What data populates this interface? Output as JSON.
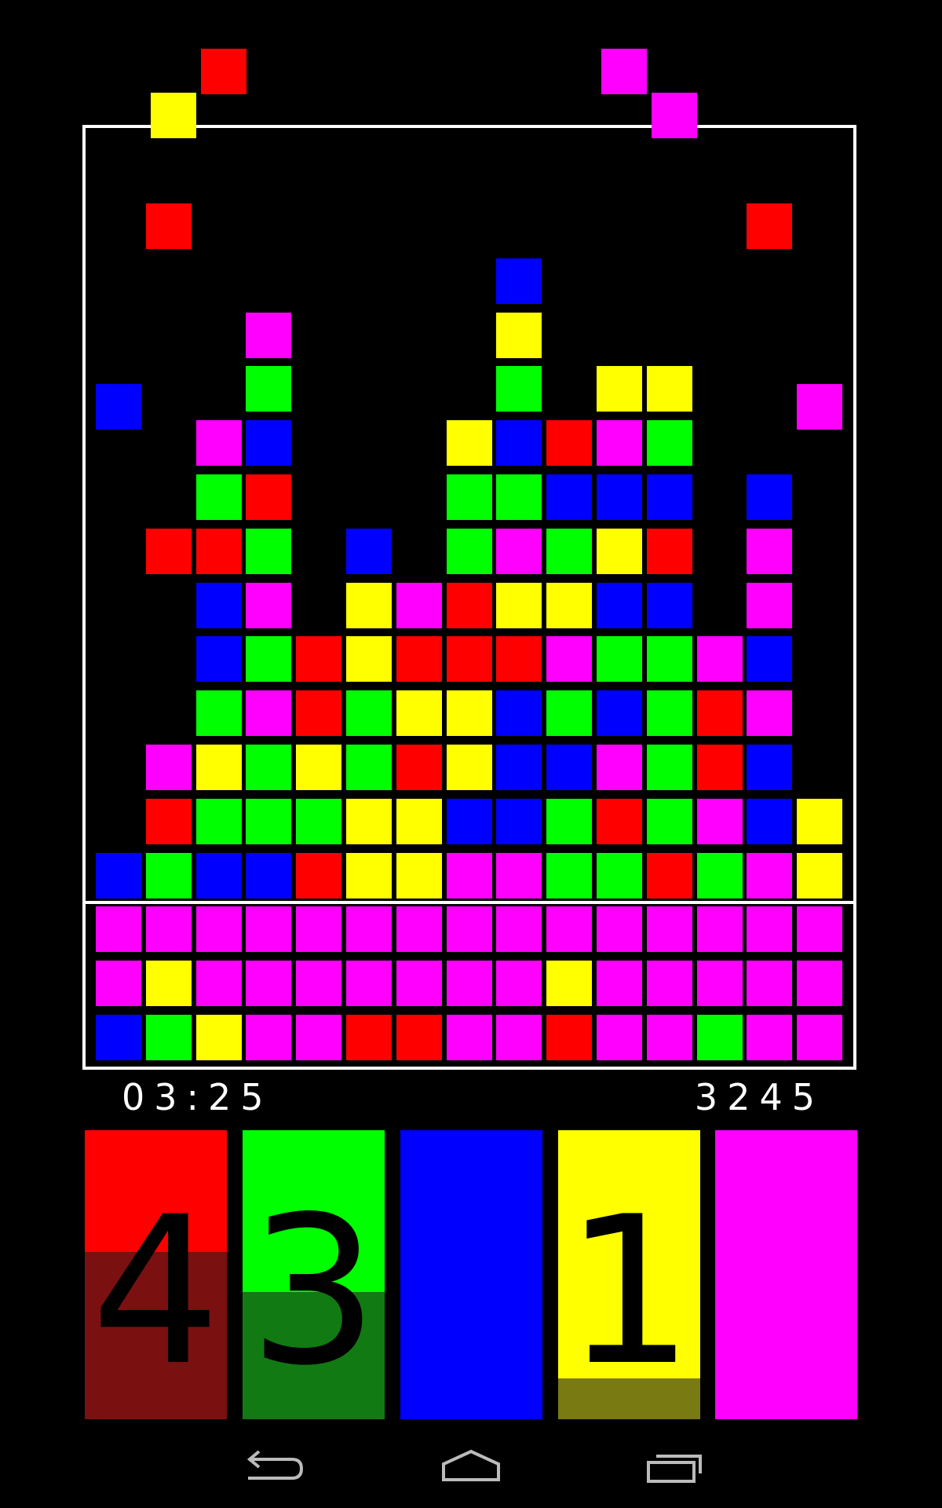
{
  "colors": {
    "R": "#ff0000",
    "G": "#00ff00",
    "B": "#0000ff",
    "Y": "#ffff00",
    "M": "#ff00ff"
  },
  "hud": {
    "timer": "03:25",
    "score": "3245"
  },
  "color_buttons": [
    {
      "color": "#ff0000",
      "shade": "#7a1010",
      "count": "4",
      "fill_fraction": 0.58
    },
    {
      "color": "#00ff00",
      "shade": "#127a12",
      "count": "3",
      "fill_fraction": 0.44
    },
    {
      "color": "#0000ff",
      "shade": "#0000ff",
      "count": "",
      "fill_fraction": 0
    },
    {
      "color": "#ffff00",
      "shade": "#7a7a12",
      "count": "1",
      "fill_fraction": 0.14
    },
    {
      "color": "#ff00ff",
      "shade": "#ff00ff",
      "count": "",
      "fill_fraction": 0
    }
  ],
  "incoming": [
    {
      "col": 2,
      "row": 0,
      "c": "R"
    },
    {
      "col": 1,
      "row": 1,
      "c": "Y"
    },
    {
      "col": 10,
      "row": 0,
      "c": "M"
    },
    {
      "col": 11,
      "row": 1,
      "c": "M"
    }
  ],
  "falling": [
    {
      "col": 1,
      "row": 3,
      "c": "R"
    },
    {
      "col": 13,
      "row": 3,
      "c": "R"
    },
    {
      "col": 0,
      "row": 6,
      "c": "B"
    },
    {
      "col": 14,
      "row": 6,
      "c": "M"
    }
  ],
  "columns": [
    [
      "B",
      "M",
      "M",
      "B"
    ],
    [
      "G",
      "Y",
      "M",
      "G",
      "R",
      "M",
      "",
      "",
      "",
      "R"
    ],
    [
      "Y",
      "M",
      "M",
      "B",
      "G",
      "Y",
      "G",
      "B",
      "B",
      "R",
      "G",
      "M"
    ],
    [
      "M",
      "M",
      "M",
      "B",
      "G",
      "G",
      "M",
      "G",
      "M",
      "G",
      "R",
      "B",
      "G",
      "M"
    ],
    [
      "M",
      "M",
      "M",
      "R",
      "G",
      "Y",
      "R",
      "R"
    ],
    [
      "R",
      "M",
      "M",
      "Y",
      "Y",
      "G",
      "G",
      "Y",
      "Y",
      "B"
    ],
    [
      "R",
      "M",
      "M",
      "Y",
      "Y",
      "R",
      "Y",
      "R",
      "M"
    ],
    [
      "M",
      "M",
      "M",
      "M",
      "B",
      "Y",
      "Y",
      "R",
      "R",
      "G",
      "G",
      "Y"
    ],
    [
      "M",
      "M",
      "M",
      "M",
      "B",
      "B",
      "B",
      "R",
      "Y",
      "M",
      "G",
      "B",
      "G",
      "Y",
      "B"
    ],
    [
      "R",
      "Y",
      "M",
      "G",
      "G",
      "B",
      "G",
      "M",
      "Y",
      "G",
      "B",
      "R"
    ],
    [
      "M",
      "M",
      "M",
      "G",
      "R",
      "M",
      "B",
      "G",
      "B",
      "Y",
      "B",
      "M",
      "Y"
    ],
    [
      "M",
      "M",
      "M",
      "R",
      "G",
      "G",
      "G",
      "G",
      "B",
      "R",
      "B",
      "G",
      "Y"
    ],
    [
      "G",
      "M",
      "M",
      "G",
      "M",
      "R",
      "R",
      "M"
    ],
    [
      "M",
      "M",
      "M",
      "M",
      "B",
      "B",
      "M",
      "B",
      "M",
      "M",
      "B"
    ],
    [
      "M",
      "M",
      "M",
      "Y",
      "Y"
    ]
  ]
}
